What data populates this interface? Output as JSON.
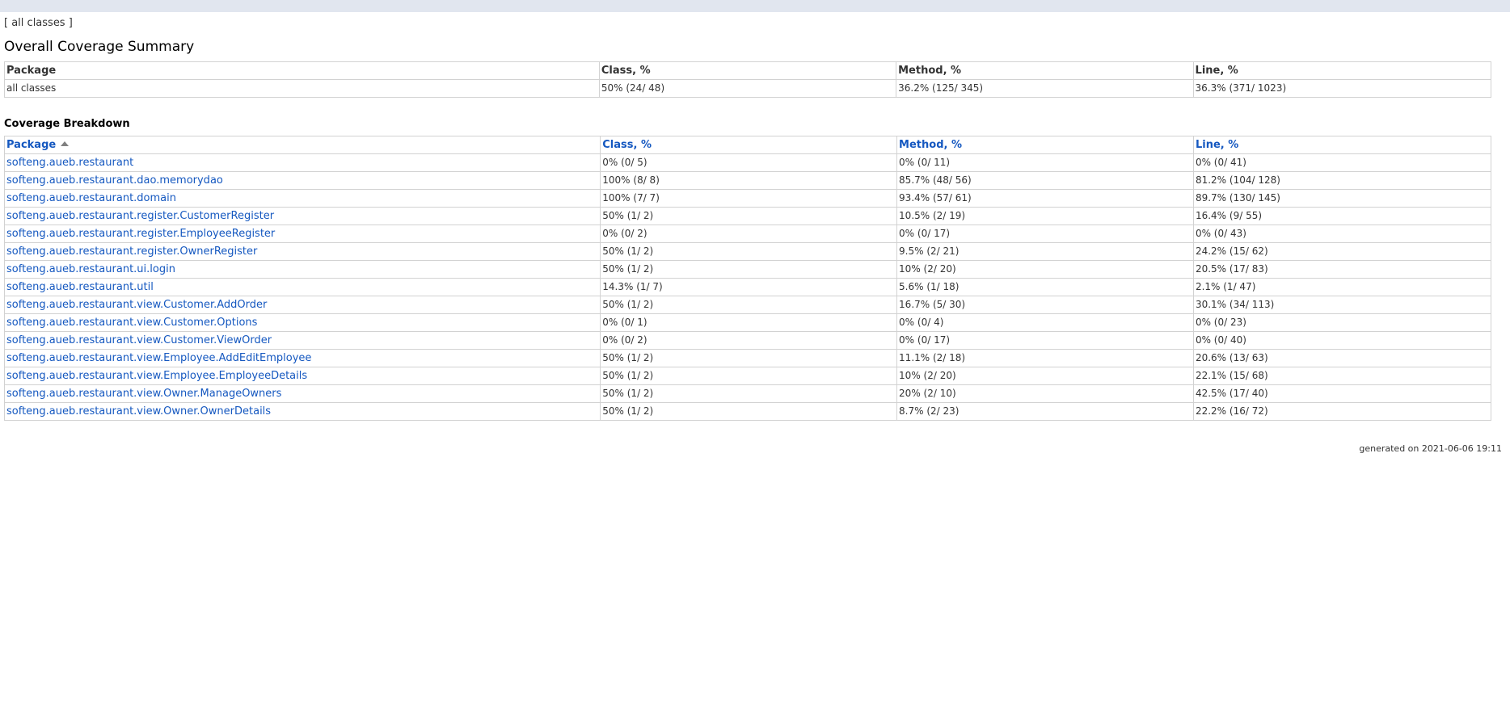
{
  "breadcrumb": {
    "open": "[",
    "label": "all classes",
    "close": "]"
  },
  "summary": {
    "title": "Overall Coverage Summary",
    "headers": [
      "Package",
      "Class, %",
      "Method, %",
      "Line, %"
    ],
    "row": [
      "all classes",
      "50% (24/ 48)",
      "36.2% (125/ 345)",
      "36.3% (371/ 1023)"
    ]
  },
  "breakdown": {
    "title": "Coverage Breakdown",
    "headers": [
      "Package",
      "Class, %",
      "Method, %",
      "Line, %"
    ],
    "rows": [
      [
        "softeng.aueb.restaurant",
        "0% (0/ 5)",
        "0% (0/ 11)",
        "0% (0/ 41)"
      ],
      [
        "softeng.aueb.restaurant.dao.memorydao",
        "100% (8/ 8)",
        "85.7% (48/ 56)",
        "81.2% (104/ 128)"
      ],
      [
        "softeng.aueb.restaurant.domain",
        "100% (7/ 7)",
        "93.4% (57/ 61)",
        "89.7% (130/ 145)"
      ],
      [
        "softeng.aueb.restaurant.register.CustomerRegister",
        "50% (1/ 2)",
        "10.5% (2/ 19)",
        "16.4% (9/ 55)"
      ],
      [
        "softeng.aueb.restaurant.register.EmployeeRegister",
        "0% (0/ 2)",
        "0% (0/ 17)",
        "0% (0/ 43)"
      ],
      [
        "softeng.aueb.restaurant.register.OwnerRegister",
        "50% (1/ 2)",
        "9.5% (2/ 21)",
        "24.2% (15/ 62)"
      ],
      [
        "softeng.aueb.restaurant.ui.login",
        "50% (1/ 2)",
        "10% (2/ 20)",
        "20.5% (17/ 83)"
      ],
      [
        "softeng.aueb.restaurant.util",
        "14.3% (1/ 7)",
        "5.6% (1/ 18)",
        "2.1% (1/ 47)"
      ],
      [
        "softeng.aueb.restaurant.view.Customer.AddOrder",
        "50% (1/ 2)",
        "16.7% (5/ 30)",
        "30.1% (34/ 113)"
      ],
      [
        "softeng.aueb.restaurant.view.Customer.Options",
        "0% (0/ 1)",
        "0% (0/ 4)",
        "0% (0/ 23)"
      ],
      [
        "softeng.aueb.restaurant.view.Customer.ViewOrder",
        "0% (0/ 2)",
        "0% (0/ 17)",
        "0% (0/ 40)"
      ],
      [
        "softeng.aueb.restaurant.view.Employee.AddEditEmployee",
        "50% (1/ 2)",
        "11.1% (2/ 18)",
        "20.6% (13/ 63)"
      ],
      [
        "softeng.aueb.restaurant.view.Employee.EmployeeDetails",
        "50% (1/ 2)",
        "10% (2/ 20)",
        "22.1% (15/ 68)"
      ],
      [
        "softeng.aueb.restaurant.view.Owner.ManageOwners",
        "50% (1/ 2)",
        "20% (2/ 10)",
        "42.5% (17/ 40)"
      ],
      [
        "softeng.aueb.restaurant.view.Owner.OwnerDetails",
        "50% (1/ 2)",
        "8.7% (2/ 23)",
        "22.2% (16/ 72)"
      ]
    ]
  },
  "footer": {
    "text": "generated on 2021-06-06 19:11"
  },
  "colors": {
    "link": "#1558c0",
    "topbar": "#e1e6ef",
    "border": "#d2d2d2"
  },
  "icons": {
    "sort": "sort-ascending-icon"
  }
}
